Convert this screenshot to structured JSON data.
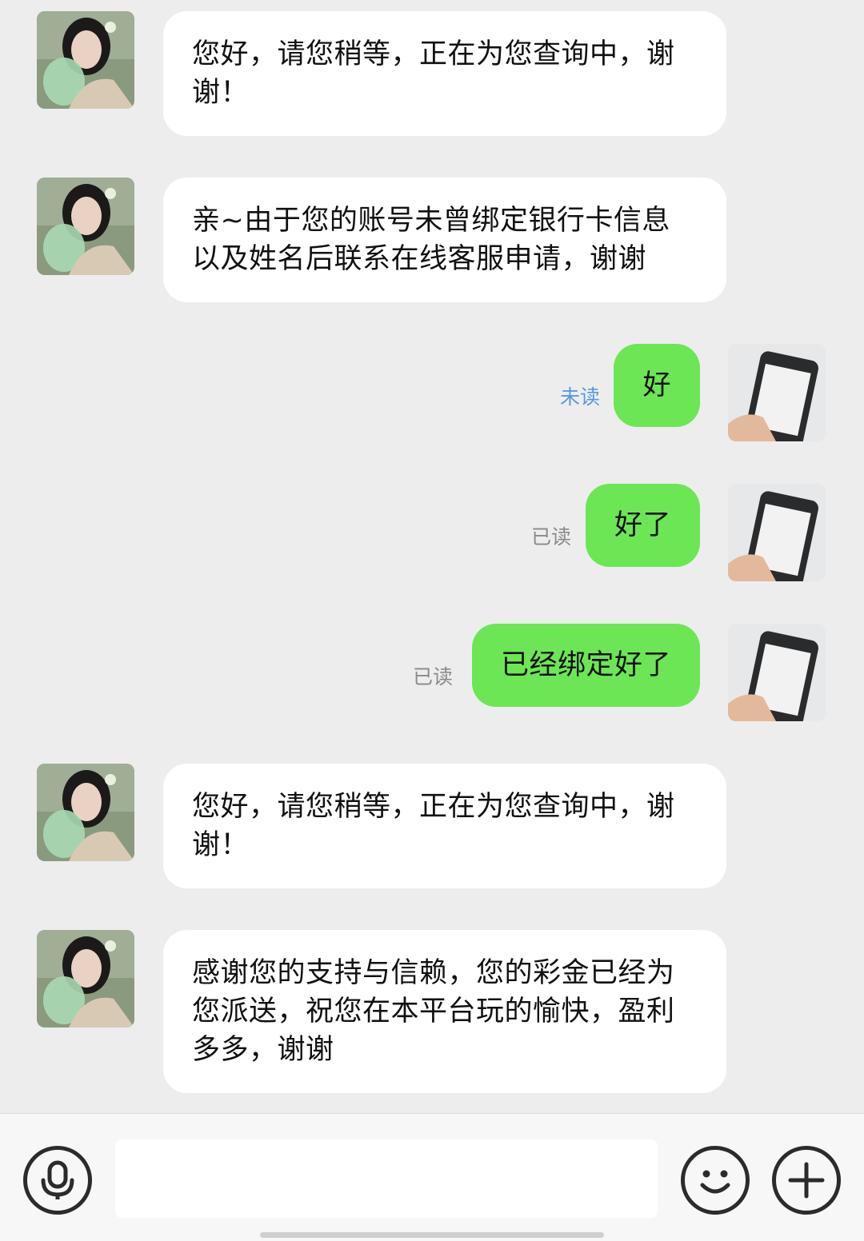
{
  "messages": [
    {
      "from": "agent",
      "text": "您好，请您稍等，正在为您查询中，谢谢！"
    },
    {
      "from": "agent",
      "text": "亲~由于您的账号未曾绑定银行卡信息以及姓名后联系在线客服申请，谢谢"
    },
    {
      "from": "user",
      "text": "好",
      "status": "未读"
    },
    {
      "from": "user",
      "text": "好了",
      "status": "已读"
    },
    {
      "from": "user",
      "text": "已经绑定好了",
      "status": "已读"
    },
    {
      "from": "agent",
      "text": "您好，请您稍等，正在为您查询中，谢谢！"
    },
    {
      "from": "agent",
      "text": "感谢您的支持与信赖，您的彩金已经为您派送，祝您在本平台玩的愉快，盈利多多，谢谢"
    }
  ],
  "input": {
    "value": "",
    "placeholder": ""
  },
  "icons": {
    "voice": "microphone-icon",
    "emoji": "smiley-icon",
    "more": "plus-icon"
  },
  "colors": {
    "background": "#ededed",
    "agent_bubble": "#ffffff",
    "user_bubble": "#6ce655",
    "unread_status": "#5a98dd",
    "read_status": "#8a8a8a"
  }
}
